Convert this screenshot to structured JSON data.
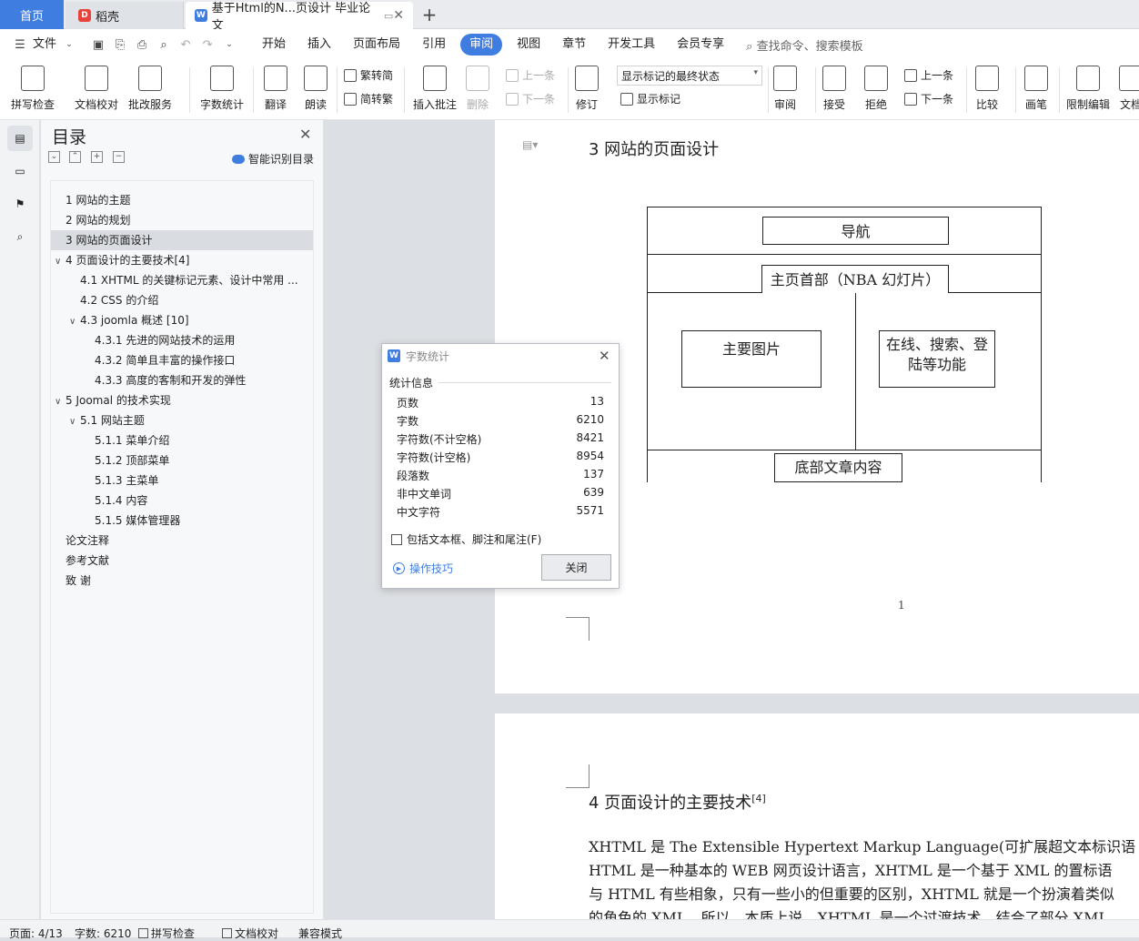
{
  "tabs": {
    "home": "首页",
    "daoke": "稻壳",
    "document": "基于Html的N...页设计 毕业论文",
    "add": "+"
  },
  "menu": {
    "file": "文件",
    "items": [
      "开始",
      "插入",
      "页面布局",
      "引用",
      "审阅",
      "视图",
      "章节",
      "开发工具",
      "会员专享"
    ],
    "active": "审阅",
    "search": "查找命令、搜索模板"
  },
  "ribbon": {
    "spell_check": "拼写检查",
    "doc_proof": "文档校对",
    "correction_service": "批改服务",
    "word_count": "字数统计",
    "translate": "翻译",
    "read_aloud": "朗读",
    "to_traditional": "繁转简",
    "to_simplified": "简转繁",
    "insert_comment": "插入批注",
    "delete": "删除",
    "prev": "上一条",
    "next": "下一条",
    "track_changes": "修订",
    "markup_state": "显示标记的最终状态",
    "show_markup": "显示标记",
    "review": "审阅",
    "accept": "接受",
    "reject": "拒绝",
    "prev2": "上一条",
    "next2": "下一条",
    "compare": "比较",
    "pen": "画笔",
    "restrict_edit": "限制编辑",
    "doc_more": "文档"
  },
  "toc": {
    "title": "目录",
    "smart": "智能识别目录",
    "items": [
      {
        "label": "1  网站的主题",
        "level": 1,
        "caret": ""
      },
      {
        "label": "2  网站的规划",
        "level": 1,
        "caret": ""
      },
      {
        "label": "3  网站的页面设计",
        "level": 1,
        "caret": "",
        "selected": true
      },
      {
        "label": "4 页面设计的主要技术[4]",
        "level": 1,
        "caret": "v"
      },
      {
        "label": "4.1 XHTML 的关键标记元素、设计中常用 ...",
        "level": 2,
        "caret": ""
      },
      {
        "label": "4.2 CSS 的介绍",
        "level": 2,
        "caret": ""
      },
      {
        "label": "4.3 joomla 概述  [10]",
        "level": 2,
        "caret": "v"
      },
      {
        "label": "4.3.1 先进的网站技术的运用",
        "level": 3,
        "caret": ""
      },
      {
        "label": "4.3.2 简单且丰富的操作接口",
        "level": 3,
        "caret": ""
      },
      {
        "label": "4.3.3 高度的客制和开发的弹性",
        "level": 3,
        "caret": ""
      },
      {
        "label": "5 Joomal 的技术实现",
        "level": 1,
        "caret": "v"
      },
      {
        "label": "5.1 网站主题",
        "level": 2,
        "caret": "v"
      },
      {
        "label": "5.1.1 菜单介绍",
        "level": 3,
        "caret": ""
      },
      {
        "label": "5.1.2  顶部菜单",
        "level": 3,
        "caret": ""
      },
      {
        "label": "5.1.3  主菜单",
        "level": 3,
        "caret": ""
      },
      {
        "label": "5.1.4  内容",
        "level": 3,
        "caret": ""
      },
      {
        "label": "5.1.5  媒体管理器",
        "level": 3,
        "caret": ""
      },
      {
        "label": "论文注释",
        "level": 1,
        "caret": ""
      },
      {
        "label": "参考文献",
        "level": 1,
        "caret": ""
      },
      {
        "label": "致    谢",
        "level": 1,
        "caret": ""
      }
    ]
  },
  "document": {
    "page1_heading": "3  网站的页面设计",
    "diagram": {
      "nav": "导航",
      "header": "主页首部（NBA 幻灯片）",
      "main_image": "主要图片",
      "online": "在线、搜索、登陆等功能",
      "footer": "底部文章内容"
    },
    "page_number": "1",
    "page2_heading": "4 页面设计的主要技术",
    "page2_heading_sup": "[4]",
    "body_lines": [
      "    XHTML 是 The Extensible Hypertext Markup Language(可扩展超文本标识语",
      "HTML 是一种基本的 WEB 网页设计语言，XHTML 是一个基于 XML 的置标语",
      "与 HTML 有些相象，只有一些小的但重要的区别，XHTML 就是一个扮演着类似",
      "的角色的 XML，所以，本质上说，XHTML 是一个过渡技术，结合了部分 XML"
    ]
  },
  "word_count_dialog": {
    "title": "字数统计",
    "section": "统计信息",
    "rows": [
      {
        "label": "页数",
        "value": "13"
      },
      {
        "label": "字数",
        "value": "6210"
      },
      {
        "label": "字符数(不计空格)",
        "value": "8421"
      },
      {
        "label": "字符数(计空格)",
        "value": "8954"
      },
      {
        "label": "段落数",
        "value": "137"
      },
      {
        "label": "非中文单词",
        "value": "639"
      },
      {
        "label": "中文字符",
        "value": "5571"
      }
    ],
    "include_option": "包括文本框、脚注和尾注(F)",
    "tips": "操作技巧",
    "close": "关闭"
  },
  "status": {
    "page": "页面: 4/13",
    "words": "字数: 6210",
    "spell": "拼写检查",
    "proof": "文档校对",
    "compat": "兼容模式"
  },
  "colors": {
    "accent": "#3f7de0",
    "dialog_border": "#b9bdc3"
  }
}
